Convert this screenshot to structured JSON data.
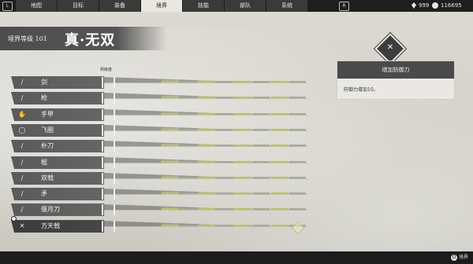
{
  "tabs": [
    {
      "label": "地图"
    },
    {
      "label": "目标"
    },
    {
      "label": "装备"
    },
    {
      "label": "境界"
    },
    {
      "label": "技能"
    },
    {
      "label": "部队"
    },
    {
      "label": "系统"
    }
  ],
  "active_tab": "境界",
  "nav": {
    "left_key": "L",
    "right_key": "R"
  },
  "currency": {
    "gems": "999",
    "coins": "116695"
  },
  "header": {
    "level_label": "境界等级 101",
    "realm_name": "真·无双"
  },
  "column_header": "熟练度",
  "weapons": [
    {
      "icon": "sword-icon",
      "glyph": "/",
      "label": "剑"
    },
    {
      "icon": "spear-icon",
      "glyph": "/",
      "label": "枪"
    },
    {
      "icon": "gauntlet-icon",
      "glyph": "✋",
      "label": "手甲"
    },
    {
      "icon": "chakram-icon",
      "glyph": "◯",
      "label": "飞圈"
    },
    {
      "icon": "blade-icon",
      "glyph": "/",
      "label": "朴刀"
    },
    {
      "icon": "club-icon",
      "glyph": "/",
      "label": "棍"
    },
    {
      "icon": "halberd-icon",
      "glyph": "/",
      "label": "双戟"
    },
    {
      "icon": "pike-icon",
      "glyph": "/",
      "label": "矛"
    },
    {
      "icon": "crescent-blade-icon",
      "glyph": "/",
      "label": "偃月刀"
    },
    {
      "icon": "sky-halberd-icon",
      "glyph": "✕",
      "label": "方天戟"
    }
  ],
  "selected_weapon": "方天戟",
  "info_panel": {
    "title": "增加防御力",
    "description": "防御力增加10。"
  },
  "bottom": {
    "button_key": "O",
    "button_label": "境界"
  }
}
